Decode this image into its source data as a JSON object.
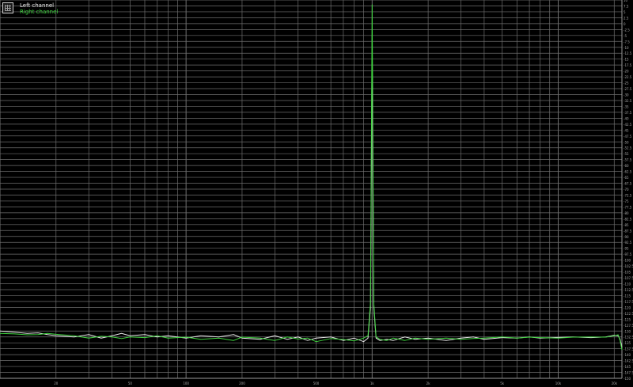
{
  "colors": {
    "background": "#000000",
    "grid": "#6e6e6e",
    "axis_text": "#a8a8a8",
    "left_channel": "#e8e8e8",
    "right_channel": "#3fd43f"
  },
  "legend": {
    "icon": "legend-grid-icon",
    "entries": [
      "Left channel",
      "Right channel"
    ]
  },
  "chart_data": {
    "type": "line",
    "x_scale": "log",
    "xlim": [
      10,
      22000
    ],
    "ylim": [
      -150,
      10
    ],
    "y_tick_step": 2.5,
    "grid": true,
    "legend_position": "top-left",
    "x_tick_labels": [
      "20",
      "50",
      "100",
      "200",
      "500",
      "1k",
      "2k",
      "5k",
      "10k",
      "20k"
    ],
    "series": [
      {
        "name": "Left channel",
        "color": "#e8e8e8",
        "x": [
          10,
          12,
          14,
          16,
          18,
          20,
          25,
          30,
          35,
          40,
          45,
          50,
          60,
          70,
          80,
          100,
          120,
          150,
          180,
          200,
          250,
          300,
          350,
          400,
          450,
          500,
          600,
          700,
          800,
          900,
          950,
          980,
          1000,
          1020,
          1050,
          1100,
          1200,
          1300,
          1500,
          1700,
          2000,
          2500,
          3000,
          3500,
          4000,
          5000,
          6000,
          7000,
          8000,
          10000,
          12000,
          15000,
          18000,
          20000,
          21000,
          21500,
          22000
        ],
        "y": [
          -130,
          -130.5,
          -131,
          -130.8,
          -131.5,
          -132,
          -132.5,
          -131.5,
          -133,
          -132,
          -131,
          -132,
          -131.5,
          -132.5,
          -132,
          -133,
          -132,
          -132.5,
          -131.5,
          -133,
          -133.5,
          -132,
          -133.5,
          -132.5,
          -134,
          -133,
          -132.5,
          -134,
          -133,
          -134.5,
          -133,
          -120,
          -5,
          -120,
          -133,
          -134,
          -133.5,
          -134,
          -132.5,
          -133.5,
          -133,
          -134,
          -133,
          -132.5,
          -133.5,
          -132.8,
          -133,
          -132.5,
          -133,
          -132.7,
          -132.5,
          -132.8,
          -132.5,
          -131.8,
          -132,
          -133.5,
          -137
        ]
      },
      {
        "name": "Right channel",
        "color": "#3fd43f",
        "x": [
          10,
          12,
          14,
          16,
          18,
          20,
          25,
          30,
          35,
          40,
          45,
          50,
          60,
          70,
          80,
          100,
          120,
          150,
          180,
          200,
          250,
          300,
          350,
          400,
          450,
          500,
          600,
          700,
          800,
          900,
          950,
          980,
          1000,
          1020,
          1050,
          1100,
          1200,
          1300,
          1500,
          1700,
          2000,
          2500,
          3000,
          3500,
          4000,
          5000,
          6000,
          7000,
          8000,
          10000,
          12000,
          15000,
          18000,
          20000,
          21000,
          21500,
          22000
        ],
        "y": [
          -131,
          -131.2,
          -131.6,
          -131.5,
          -131,
          -131.4,
          -132,
          -133,
          -132.2,
          -132.5,
          -133.2,
          -132.5,
          -132.8,
          -132,
          -133,
          -132.6,
          -133.5,
          -133,
          -134,
          -132.6,
          -133,
          -134,
          -132.5,
          -133.4,
          -133,
          -134.5,
          -133.2,
          -133.6,
          -134.2,
          -133,
          -132,
          -118,
          8,
          -118,
          -132.5,
          -133.5,
          -134,
          -133,
          -134,
          -133,
          -133.5,
          -133,
          -133.5,
          -133.2,
          -133,
          -132.5,
          -133,
          -132.6,
          -132.8,
          -133,
          -132.6,
          -132.5,
          -132.6,
          -132,
          -131.6,
          -134,
          -138
        ]
      }
    ]
  }
}
